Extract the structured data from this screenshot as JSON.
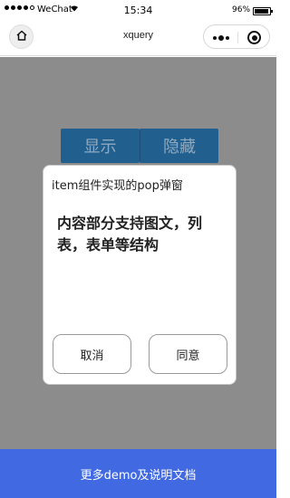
{
  "status_bar": {
    "carrier": "WeChat",
    "time": "15:34",
    "battery_percent": "96%",
    "battery_level": 0.96
  },
  "nav_bar": {
    "title": "xquery",
    "home_icon": "home-icon",
    "more_icon": "more-icon",
    "close_icon": "close-icon"
  },
  "main": {
    "buttons": [
      {
        "label": "显示"
      },
      {
        "label": "隐藏"
      }
    ]
  },
  "popup": {
    "title": "item组件实现的pop弹窗",
    "body": "内容部分支持图文，列表，表单等结构",
    "cancel_label": "取消",
    "confirm_label": "同意"
  },
  "bottom_bar": {
    "label": "更多demo及说明文档"
  },
  "colors": {
    "overlay": "#8c8c8c",
    "top_button": "#215f8f",
    "bottom_bar": "#4169e1"
  }
}
